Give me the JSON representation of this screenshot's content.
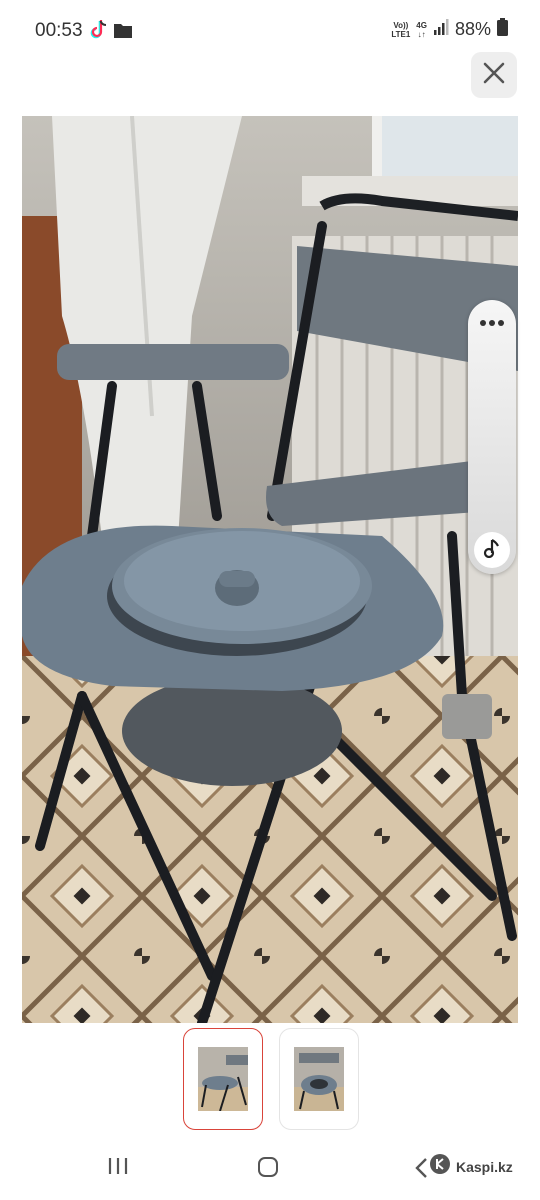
{
  "status_bar": {
    "time": "00:53",
    "network_top": "Vo))",
    "network_bottom": "LTE1",
    "network_type": "4G",
    "battery": "88%",
    "icons": [
      "tiktok-icon",
      "folder-icon",
      "signal-icon",
      "battery-icon"
    ]
  },
  "viewer": {
    "close_icon": "close-icon",
    "side_panel": {
      "more_icon": "more-horizontal-icon",
      "music_icon": "music-note-icon"
    },
    "thumbnails": [
      {
        "name": "thumbnail-1",
        "selected": true
      },
      {
        "name": "thumbnail-2",
        "selected": false
      }
    ]
  },
  "nav_bar": {
    "icons": [
      "recents-icon",
      "home-icon",
      "back-icon"
    ],
    "brand": "Kaspi.kz"
  },
  "colors": {
    "selected_thumbnail_border": "#d9443a",
    "close_button_bg": "#eeeeee"
  }
}
